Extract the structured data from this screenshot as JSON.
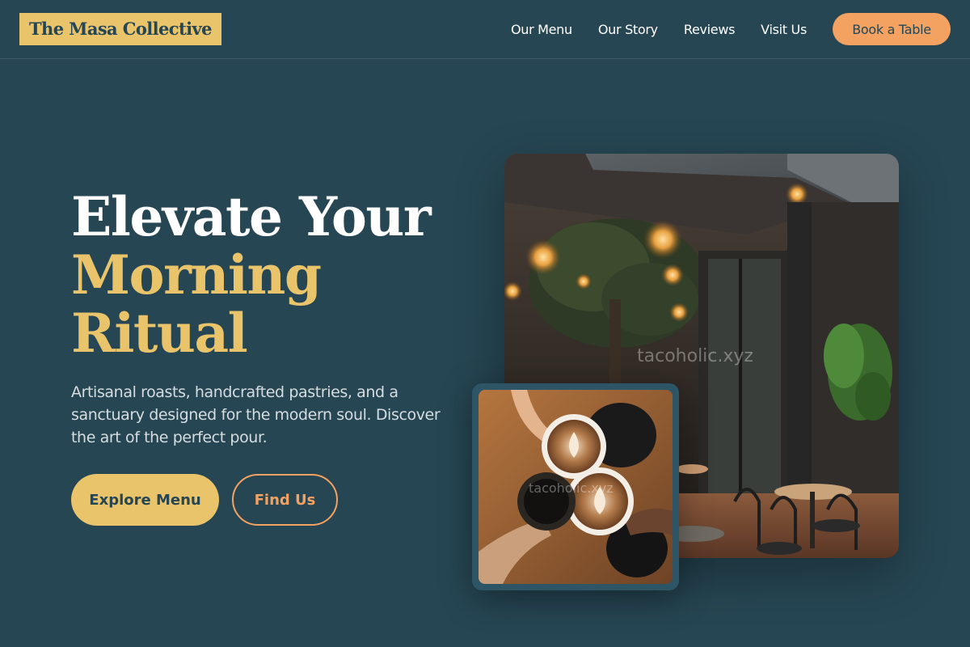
{
  "brand": {
    "logo_text": "The Masa Collective"
  },
  "nav": {
    "items": [
      {
        "label": "Our Menu"
      },
      {
        "label": "Our Story"
      },
      {
        "label": "Reviews"
      },
      {
        "label": "Visit Us"
      }
    ],
    "cta_label": "Book a Table"
  },
  "hero": {
    "title_line1": "Elevate Your",
    "title_line2": "Morning Ritual",
    "subtitle": "Artisanal roasts, handcrafted pastries, and a sanctuary designed for the modern soul. Discover the art of the perfect pour.",
    "primary_button": "Explore Menu",
    "secondary_button": "Find Us"
  },
  "images": {
    "main_watermark": "tacoholic.xyz",
    "small_watermark": "tacoholic.xyz"
  },
  "colors": {
    "background": "#264653",
    "gold": "#e9c46a",
    "orange": "#f4a261",
    "text": "#ffffff"
  }
}
